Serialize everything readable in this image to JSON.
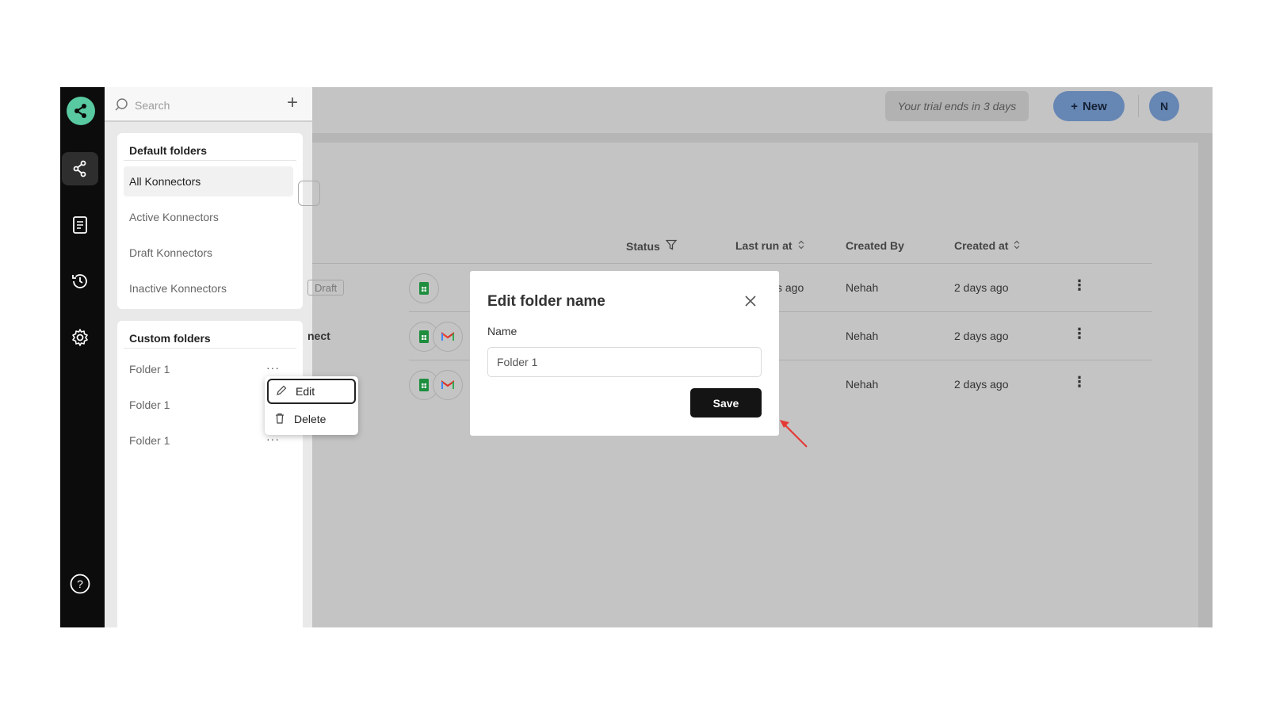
{
  "search": {
    "placeholder": "Search"
  },
  "default_folders": {
    "title": "Default folders",
    "items": [
      "All Konnectors",
      "Active Konnectors",
      "Draft Konnectors",
      "Inactive Konnectors"
    ],
    "active": "All Konnectors"
  },
  "custom_folders": {
    "title": "Custom folders",
    "items": [
      "Folder 1",
      "Folder 1",
      "Folder 1"
    ]
  },
  "context_menu": {
    "edit": "Edit",
    "delete": "Delete"
  },
  "topbar": {
    "trial": "Your trial ends in 3 days",
    "new_label": "New",
    "avatar_initial": "N"
  },
  "table": {
    "columns": {
      "status": "Status",
      "last_run": "Last run at",
      "created_by": "Created By",
      "created_at": "Created at"
    },
    "rows": [
      {
        "badge": "Draft",
        "last_run_fragment": "s ago",
        "created_by": "Nehah",
        "created_at": "2 days ago",
        "apps": [
          "google-sheets"
        ]
      },
      {
        "name_fragment": "nect",
        "created_by": "Nehah",
        "created_at": "2 days ago",
        "apps": [
          "google-sheets",
          "gmail"
        ]
      },
      {
        "created_by": "Nehah",
        "created_at": "2 days ago",
        "apps": [
          "google-sheets",
          "gmail"
        ]
      }
    ]
  },
  "modal": {
    "title": "Edit folder name",
    "label": "Name",
    "value": "Folder 1",
    "save": "Save"
  },
  "colors": {
    "rail": "#0c0c0c",
    "brand": "#58c9a0",
    "primary": "#6686b4",
    "save": "#141414",
    "annotation": "#e53935"
  }
}
